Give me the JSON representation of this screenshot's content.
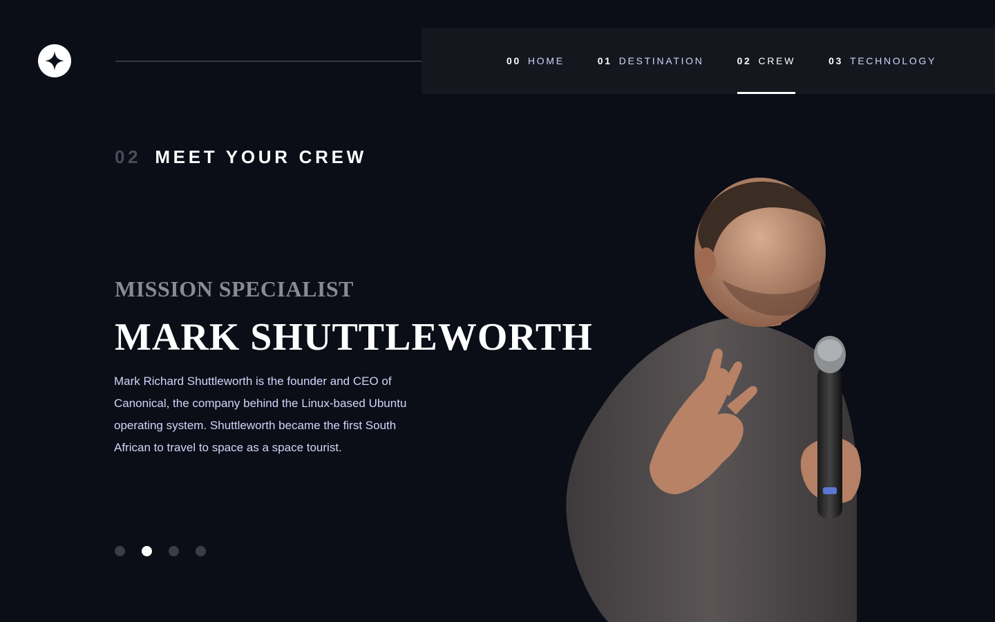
{
  "header": {
    "logo_icon": "star-logo-icon"
  },
  "nav": {
    "items": [
      {
        "num": "00",
        "label": "HOME"
      },
      {
        "num": "01",
        "label": "DESTINATION"
      },
      {
        "num": "02",
        "label": "CREW",
        "active": true
      },
      {
        "num": "03",
        "label": "TECHNOLOGY"
      }
    ]
  },
  "section": {
    "num": "02",
    "title": "MEET YOUR CREW"
  },
  "crew": {
    "role": "MISSION SPECIALIST",
    "name": "MARK SHUTTLEWORTH",
    "bio": "Mark Richard Shuttleworth is the founder and CEO of Canonical, the company behind the Linux-based Ubuntu operating system. Shuttleworth became the first South African to travel to space as a space tourist."
  },
  "pagination": {
    "count": 4,
    "active_index": 1
  },
  "colors": {
    "background": "#0b0d17",
    "nav_background": "#15171f",
    "accent_text": "#d0d6f9",
    "muted_number": "#4a4d5a",
    "role_text": "#898b93",
    "inactive_dot": "#3a3c46",
    "active_dot": "#ffffff"
  }
}
